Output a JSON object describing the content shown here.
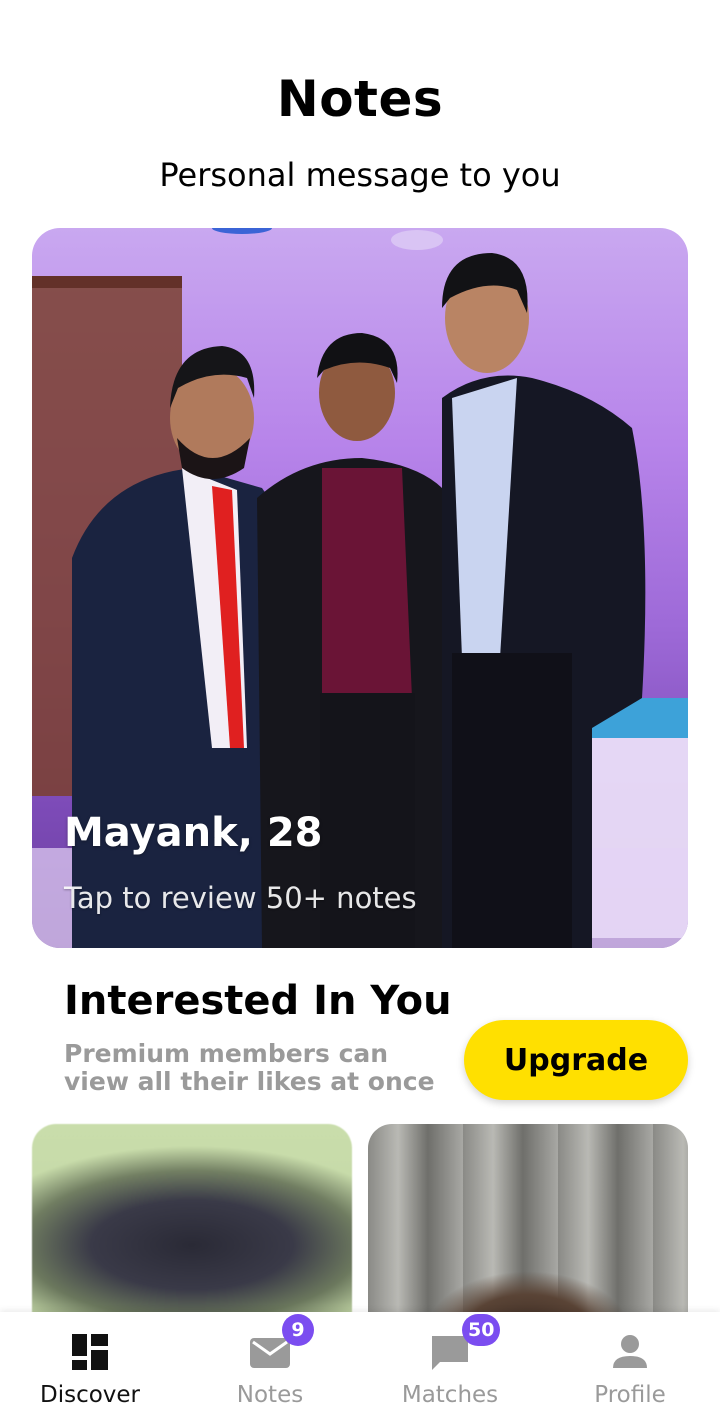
{
  "header": {
    "title": "Notes",
    "subtitle": "Personal message to you"
  },
  "hero": {
    "name_age": "Mayank, 28",
    "cta": "Tap to review 50+ notes"
  },
  "interested": {
    "title": "Interested In You",
    "description": "Premium members can view all their likes at once",
    "upgrade_label": "Upgrade"
  },
  "bottom_nav": {
    "items": [
      {
        "label": "Discover",
        "icon": "discover-icon",
        "active": true
      },
      {
        "label": "Notes",
        "icon": "mail-icon",
        "badge": "9"
      },
      {
        "label": "Matches",
        "icon": "chat-icon",
        "badge": "50"
      },
      {
        "label": "Profile",
        "icon": "person-icon"
      }
    ]
  },
  "colors": {
    "accent_yellow": "#ffe000",
    "badge_purple": "#7b4df0",
    "muted_text": "#9a9a9a"
  }
}
